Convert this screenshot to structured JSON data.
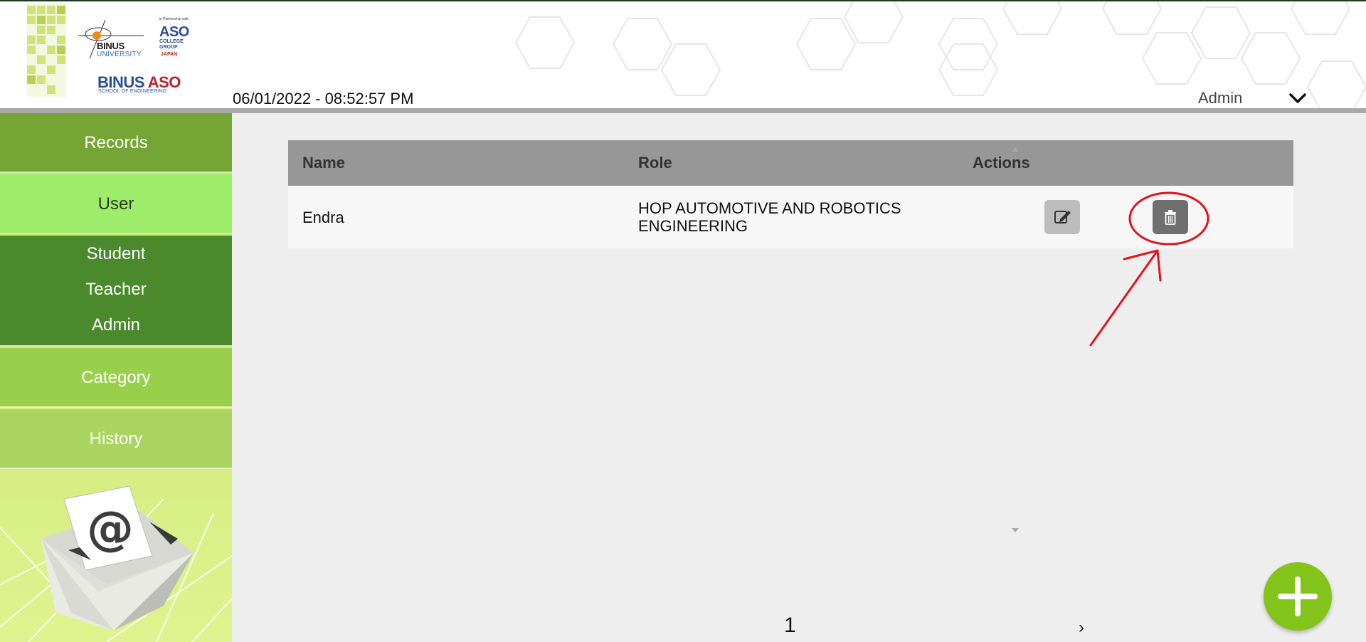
{
  "header": {
    "logo": {
      "binus_word": "BINUS",
      "binus_univ": "UNIVERSITY",
      "partner_text": "in Partnership with",
      "aso_word": "ASO",
      "aso_sub": "COLLEGE GROUP",
      "aso_japan": "JAPAN",
      "school_binus": "BINUS",
      "school_aso": "ASO",
      "school_sub": "SCHOOL OF ENGINEERING"
    },
    "datetime": "06/01/2022 - 08:52:57 PM",
    "user_name": "Admin",
    "user_menu_icon": "chevron-down-icon"
  },
  "sidebar": {
    "records": "Records",
    "user": "User",
    "sub_items": [
      "Student",
      "Teacher",
      "Admin"
    ],
    "category": "Category",
    "history": "History",
    "illustration": "envelope-email-icon"
  },
  "table": {
    "columns": [
      "Name",
      "Role",
      "Actions"
    ],
    "rows": [
      {
        "name": "Endra",
        "role": "HOP AUTOMOTIVE AND ROBOTICS ENGINEERING",
        "edit_icon": "edit-icon",
        "delete_icon": "trash-icon"
      }
    ]
  },
  "pagination": {
    "current_page": "1",
    "next": "›"
  },
  "add_button_icon": "plus-icon",
  "colors": {
    "records_bg": "#75a535",
    "user_bg": "#9ded6b",
    "submenu_bg": "#4b8a2c",
    "category_bg": "#9acf4c",
    "history_bg": "#a9d45f",
    "table_header_bg": "#979797",
    "add_button_bg": "#82c41a",
    "annotation_red": "#e0141e"
  }
}
